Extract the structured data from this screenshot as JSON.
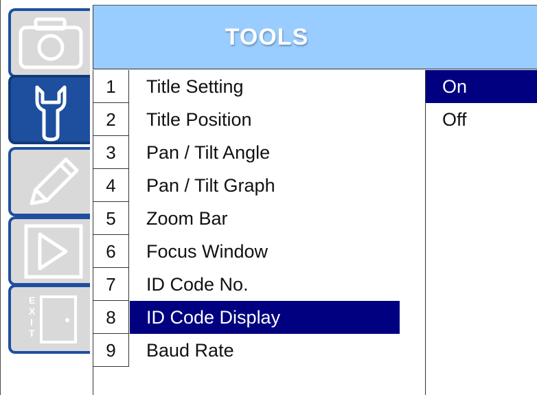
{
  "header": {
    "title": "TOOLS"
  },
  "sidebar": {
    "tabs": [
      {
        "icon": "camera-icon",
        "active": false
      },
      {
        "icon": "wrench-icon",
        "active": true
      },
      {
        "icon": "pencil-icon",
        "active": false
      },
      {
        "icon": "play-icon",
        "active": false
      },
      {
        "icon": "exit-icon",
        "active": false,
        "icon_text": "EXIT"
      }
    ]
  },
  "menu": {
    "items": [
      {
        "num": "1",
        "label": "Title Setting"
      },
      {
        "num": "2",
        "label": "Title Position"
      },
      {
        "num": "3",
        "label": "Pan / Tilt Angle"
      },
      {
        "num": "4",
        "label": "Pan / Tilt Graph"
      },
      {
        "num": "5",
        "label": "Zoom Bar"
      },
      {
        "num": "6",
        "label": "Focus Window"
      },
      {
        "num": "7",
        "label": "ID Code No."
      },
      {
        "num": "8",
        "label": "ID Code Display"
      },
      {
        "num": "9",
        "label": "Baud Rate"
      }
    ],
    "selected_index": 7
  },
  "options": {
    "items": [
      "On",
      "Off"
    ],
    "selected_index": 0
  },
  "colors": {
    "header_bg": "#99ccff",
    "highlight": "#000080",
    "tab_active": "#1d4f9e",
    "tab_inactive": "#d9d9d9"
  }
}
